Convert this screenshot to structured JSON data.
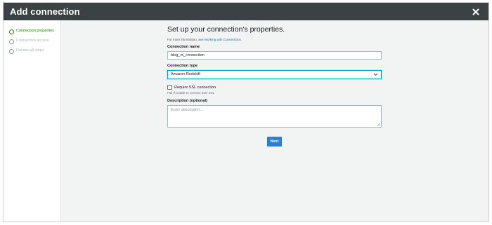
{
  "header": {
    "title": "Add connection"
  },
  "sidebar": {
    "steps": [
      {
        "label": "Connection properties",
        "state": "active"
      },
      {
        "label": "Connection access",
        "state": "inactive"
      },
      {
        "label": "Review all steps",
        "state": "inactive"
      }
    ]
  },
  "form": {
    "title": "Set up your connection's properties.",
    "info_prefix": "For more information, see ",
    "info_link": "Working with Connections.",
    "connection_name_label": "Connection name",
    "connection_name_value": "blog_rs_conneciton",
    "connection_type_label": "Connection type",
    "connection_type_value": "Amazon Redshift",
    "ssl_label": "Require SSL connection",
    "ssl_checked": false,
    "ssl_hint": "Fail if unable to connect over SSL",
    "description_label": "Description (optional)",
    "description_placeholder": "Enter description...",
    "next_label": "Next"
  },
  "colors": {
    "header_bg": "#3b4243",
    "active_step": "#1d8102",
    "link": "#0073bb",
    "primary_button": "#2b7fd0"
  }
}
